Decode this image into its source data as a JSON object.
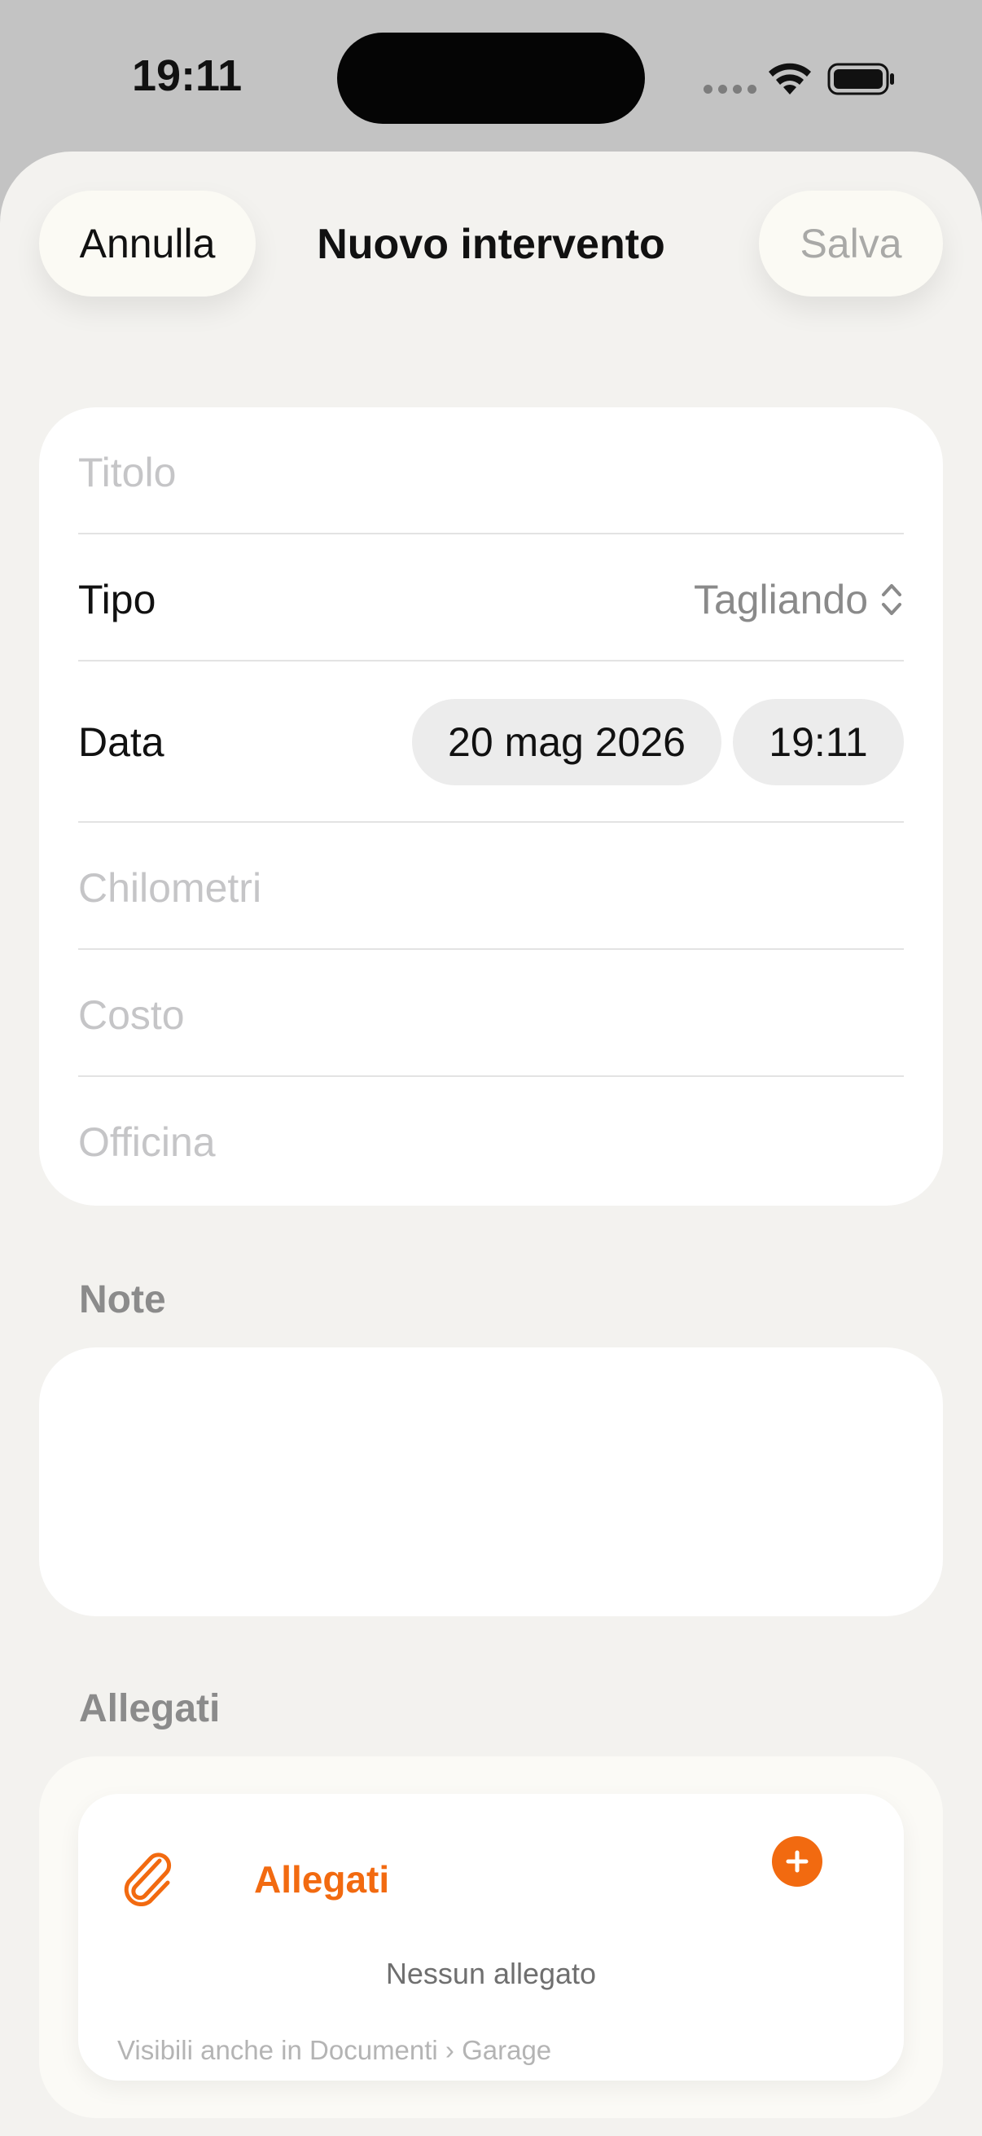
{
  "status_bar": {
    "time": "19:11"
  },
  "nav": {
    "cancel_label": "Annulla",
    "title": "Nuovo intervento",
    "save_label": "Salva"
  },
  "form": {
    "title_placeholder": "Titolo",
    "type_label": "Tipo",
    "type_value": "Tagliando",
    "date_label": "Data",
    "date_value": "20 mag 2026",
    "time_value": "19:11",
    "km_placeholder": "Chilometri",
    "cost_placeholder": "Costo",
    "workshop_placeholder": "Officina"
  },
  "notes": {
    "section_title": "Note",
    "value": ""
  },
  "attachments": {
    "section_title": "Allegati",
    "header_label": "Allegati",
    "empty_text": "Nessun allegato",
    "hint": "Visibili anche in Documenti › Garage"
  },
  "colors": {
    "accent": "#f26a10",
    "background": "#f3f2ef",
    "card": "#ffffff"
  }
}
